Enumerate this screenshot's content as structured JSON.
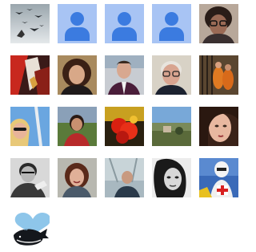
{
  "members": [
    {
      "id": "m1",
      "kind": "photo",
      "icon": "birds-silhouette-photo"
    },
    {
      "id": "m2",
      "kind": "default",
      "icon": "default-avatar-icon"
    },
    {
      "id": "m3",
      "kind": "default",
      "icon": "default-avatar-icon"
    },
    {
      "id": "m4",
      "kind": "default",
      "icon": "default-avatar-icon"
    },
    {
      "id": "m5",
      "kind": "photo",
      "icon": "person-glasses-photo"
    },
    {
      "id": "m6",
      "kind": "photo",
      "icon": "abstract-red-photo"
    },
    {
      "id": "m7",
      "kind": "photo",
      "icon": "woman-curly-hair-photo"
    },
    {
      "id": "m8",
      "kind": "photo",
      "icon": "man-suit-photo"
    },
    {
      "id": "m9",
      "kind": "photo",
      "icon": "older-man-glasses-photo"
    },
    {
      "id": "m10",
      "kind": "photo",
      "icon": "orange-figures-photo"
    },
    {
      "id": "m11",
      "kind": "photo",
      "icon": "blonde-woman-sunglasses-photo"
    },
    {
      "id": "m12",
      "kind": "photo",
      "icon": "woman-red-top-photo"
    },
    {
      "id": "m13",
      "kind": "photo",
      "icon": "red-flowers-photo"
    },
    {
      "id": "m14",
      "kind": "photo",
      "icon": "landscape-photo"
    },
    {
      "id": "m15",
      "kind": "photo",
      "icon": "young-woman-dark-hair-photo"
    },
    {
      "id": "m16",
      "kind": "photo",
      "icon": "man-bw-glasses-photo"
    },
    {
      "id": "m17",
      "kind": "photo",
      "icon": "woman-smiling-photo"
    },
    {
      "id": "m18",
      "kind": "photo",
      "icon": "man-city-photo"
    },
    {
      "id": "m19",
      "kind": "photo",
      "icon": "woman-bw-portrait-photo"
    },
    {
      "id": "m20",
      "kind": "photo",
      "icon": "stormtrooper-flag-photo"
    },
    {
      "id": "m21",
      "kind": "photo",
      "icon": "whale-logo-photo"
    }
  ],
  "colors": {
    "default_avatar_bg": "#a8c4f4",
    "default_avatar_fg": "#3b7be0"
  }
}
